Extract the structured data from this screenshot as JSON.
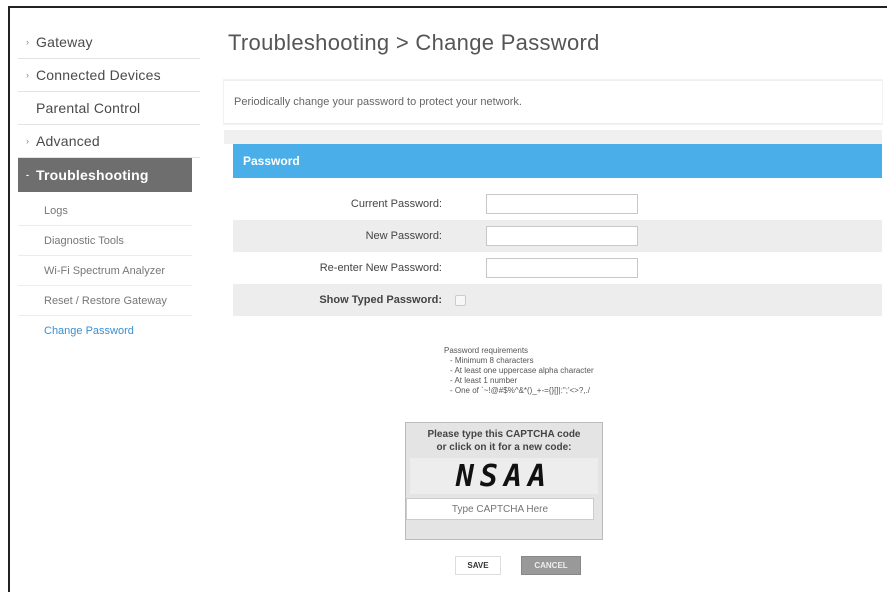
{
  "sidebar": {
    "items": [
      {
        "label": "Gateway"
      },
      {
        "label": "Connected Devices"
      },
      {
        "label": "Parental Control"
      },
      {
        "label": "Advanced"
      },
      {
        "label": "Troubleshooting"
      }
    ],
    "subitems": [
      {
        "label": "Logs"
      },
      {
        "label": "Diagnostic Tools"
      },
      {
        "label": "Wi-Fi Spectrum Analyzer"
      },
      {
        "label": "Reset / Restore Gateway"
      },
      {
        "label": "Change Password"
      }
    ]
  },
  "header": {
    "title": "Troubleshooting > Change Password"
  },
  "intro": {
    "text": "Periodically change your password to protect your network."
  },
  "panel": {
    "title": "Password",
    "fields": {
      "current": {
        "label": "Current Password:",
        "value": ""
      },
      "new": {
        "label": "New Password:",
        "value": ""
      },
      "reenter": {
        "label": "Re-enter New Password:",
        "value": ""
      }
    },
    "show_typed": {
      "label": "Show Typed Password:",
      "checked": false
    }
  },
  "requirements": {
    "title": "Password requirements",
    "items": [
      "- Minimum 8 characters",
      "- At least one uppercase alpha character",
      "- At least 1 number",
      "- One of `~!@#$%^&*()_+-={}[]|:\";'<>?,./"
    ]
  },
  "captcha": {
    "line1": "Please type this CAPTCHA code",
    "line2": "or click on it for a new code:",
    "code": "NSAA",
    "placeholder": "Type CAPTCHA Here"
  },
  "buttons": {
    "save": "SAVE",
    "cancel": "CANCEL"
  },
  "colors": {
    "accent": "#4aaee8",
    "active_nav": "#6e6e6e",
    "link": "#3a8fd0"
  }
}
